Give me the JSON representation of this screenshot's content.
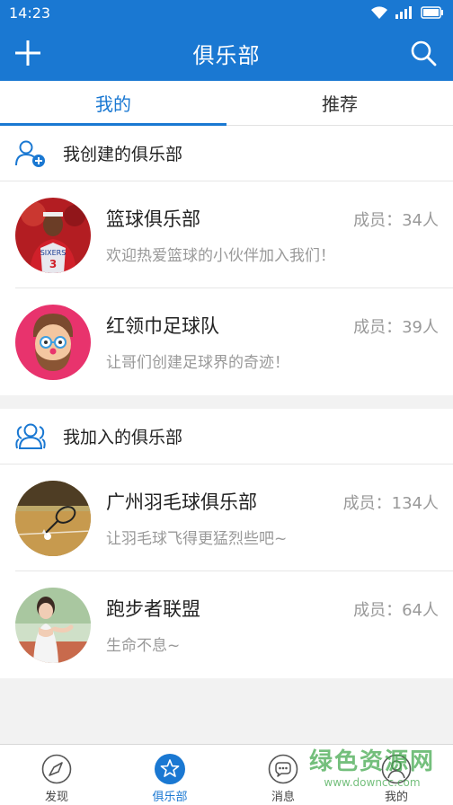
{
  "status_bar": {
    "time": "14:23"
  },
  "app_bar": {
    "title": "俱乐部"
  },
  "tabs": [
    {
      "label": "我的",
      "active": true
    },
    {
      "label": "推荐",
      "active": false
    }
  ],
  "sections": [
    {
      "title": "我创建的俱乐部",
      "clubs": [
        {
          "name": "篮球俱乐部",
          "members": "成员：34人",
          "desc": "欢迎热爱篮球的小伙伴加入我们！",
          "avatar": "basketball-player"
        },
        {
          "name": "红领巾足球队",
          "members": "成员：39人",
          "desc": "让哥们创建足球界的奇迹！",
          "avatar": "cartoon-face"
        }
      ]
    },
    {
      "title": "我加入的俱乐部",
      "clubs": [
        {
          "name": "广州羽毛球俱乐部",
          "members": "成员：134人",
          "desc": "让羽毛球飞得更猛烈些吧~",
          "avatar": "badminton-court"
        },
        {
          "name": "跑步者联盟",
          "members": "成员：64人",
          "desc": "生命不息~",
          "avatar": "runner"
        }
      ]
    }
  ],
  "bottom_nav": [
    {
      "label": "发现",
      "icon": "compass-icon",
      "active": false
    },
    {
      "label": "俱乐部",
      "icon": "star-icon",
      "active": true
    },
    {
      "label": "消息",
      "icon": "chat-icon",
      "active": false
    },
    {
      "label": "我的",
      "icon": "user-icon",
      "active": false
    }
  ],
  "watermark": {
    "text": "绿色资源网",
    "url": "www.downcc.com"
  },
  "colors": {
    "primary": "#1a78d2",
    "text": "#222222",
    "muted": "#999999"
  }
}
